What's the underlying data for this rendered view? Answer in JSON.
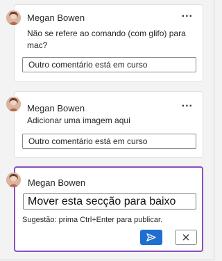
{
  "threads": [
    {
      "author": "Megan Bowen",
      "body": "Não se refere ao comando (com glifo) para mac?",
      "reply_placeholder": "Outro comentário está em curso",
      "more_label": "..."
    },
    {
      "author": "Megan Bowen",
      "body": "Adicionar uma imagem aqui",
      "reply_placeholder": "Outro comentário está em curso",
      "more_label": "..."
    }
  ],
  "draft": {
    "author": "Megan Bowen",
    "text": "Mover esta secção para baixo",
    "hint": "Sugestão: prima Ctrl+Enter para publicar."
  },
  "icons": {
    "send": "send-icon",
    "cancel": "close-icon",
    "more": "more-options-icon",
    "avatar": "avatar"
  },
  "colors": {
    "accent": "#1f6fd0",
    "active_border": "#8a4fbf"
  }
}
